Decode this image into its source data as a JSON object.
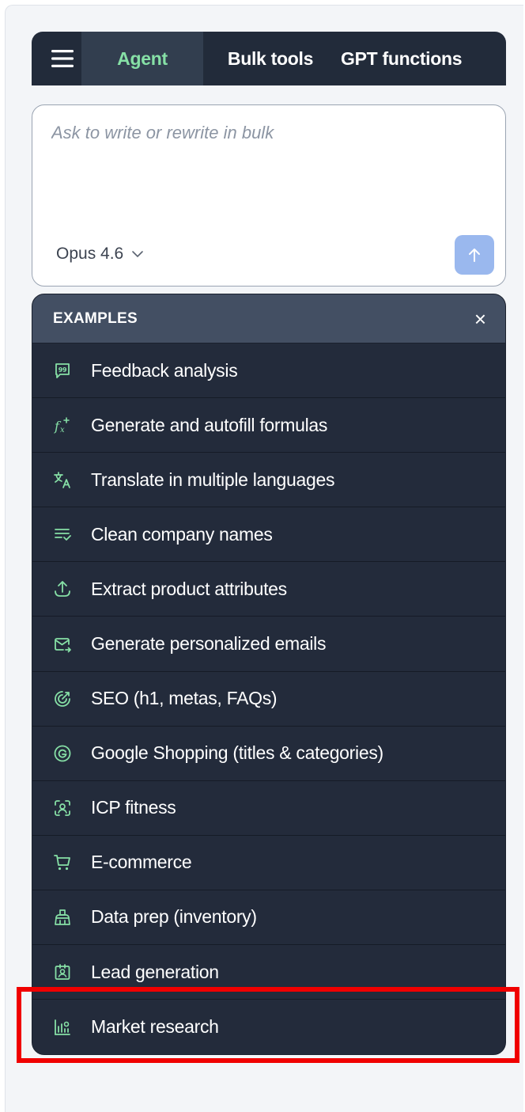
{
  "tabs": [
    {
      "label": "Agent",
      "active": true
    },
    {
      "label": "Bulk tools",
      "active": false
    },
    {
      "label": "GPT functions",
      "active": false
    }
  ],
  "prompt": {
    "placeholder": "Ask to write or rewrite in bulk",
    "model": "Opus 4.6"
  },
  "examples": {
    "title": "EXAMPLES",
    "close_glyph": "×",
    "items": [
      {
        "label": "Feedback analysis",
        "icon": "feedback-icon"
      },
      {
        "label": "Generate and autofill formulas",
        "icon": "formula-icon"
      },
      {
        "label": "Translate in multiple languages",
        "icon": "translate-icon"
      },
      {
        "label": "Clean company names",
        "icon": "clean-list-icon"
      },
      {
        "label": "Extract product attributes",
        "icon": "extract-icon"
      },
      {
        "label": "Generate personalized emails",
        "icon": "email-icon"
      },
      {
        "label": "SEO (h1, metas, FAQs)",
        "icon": "seo-icon"
      },
      {
        "label": "Google Shopping (titles & categories)",
        "icon": "google-icon"
      },
      {
        "label": "ICP fitness",
        "icon": "icp-icon"
      },
      {
        "label": "E-commerce",
        "icon": "cart-icon"
      },
      {
        "label": "Data prep (inventory)",
        "icon": "broom-icon"
      },
      {
        "label": "Lead generation",
        "icon": "contact-badge-icon"
      },
      {
        "label": "Market research",
        "icon": "chart-icon"
      }
    ]
  },
  "colors": {
    "accent_green": "#86e0a6",
    "dark_bg": "#232b3b",
    "header_bg": "#434f63",
    "send_button": "#9ab8ee",
    "highlight": "#f00000"
  }
}
